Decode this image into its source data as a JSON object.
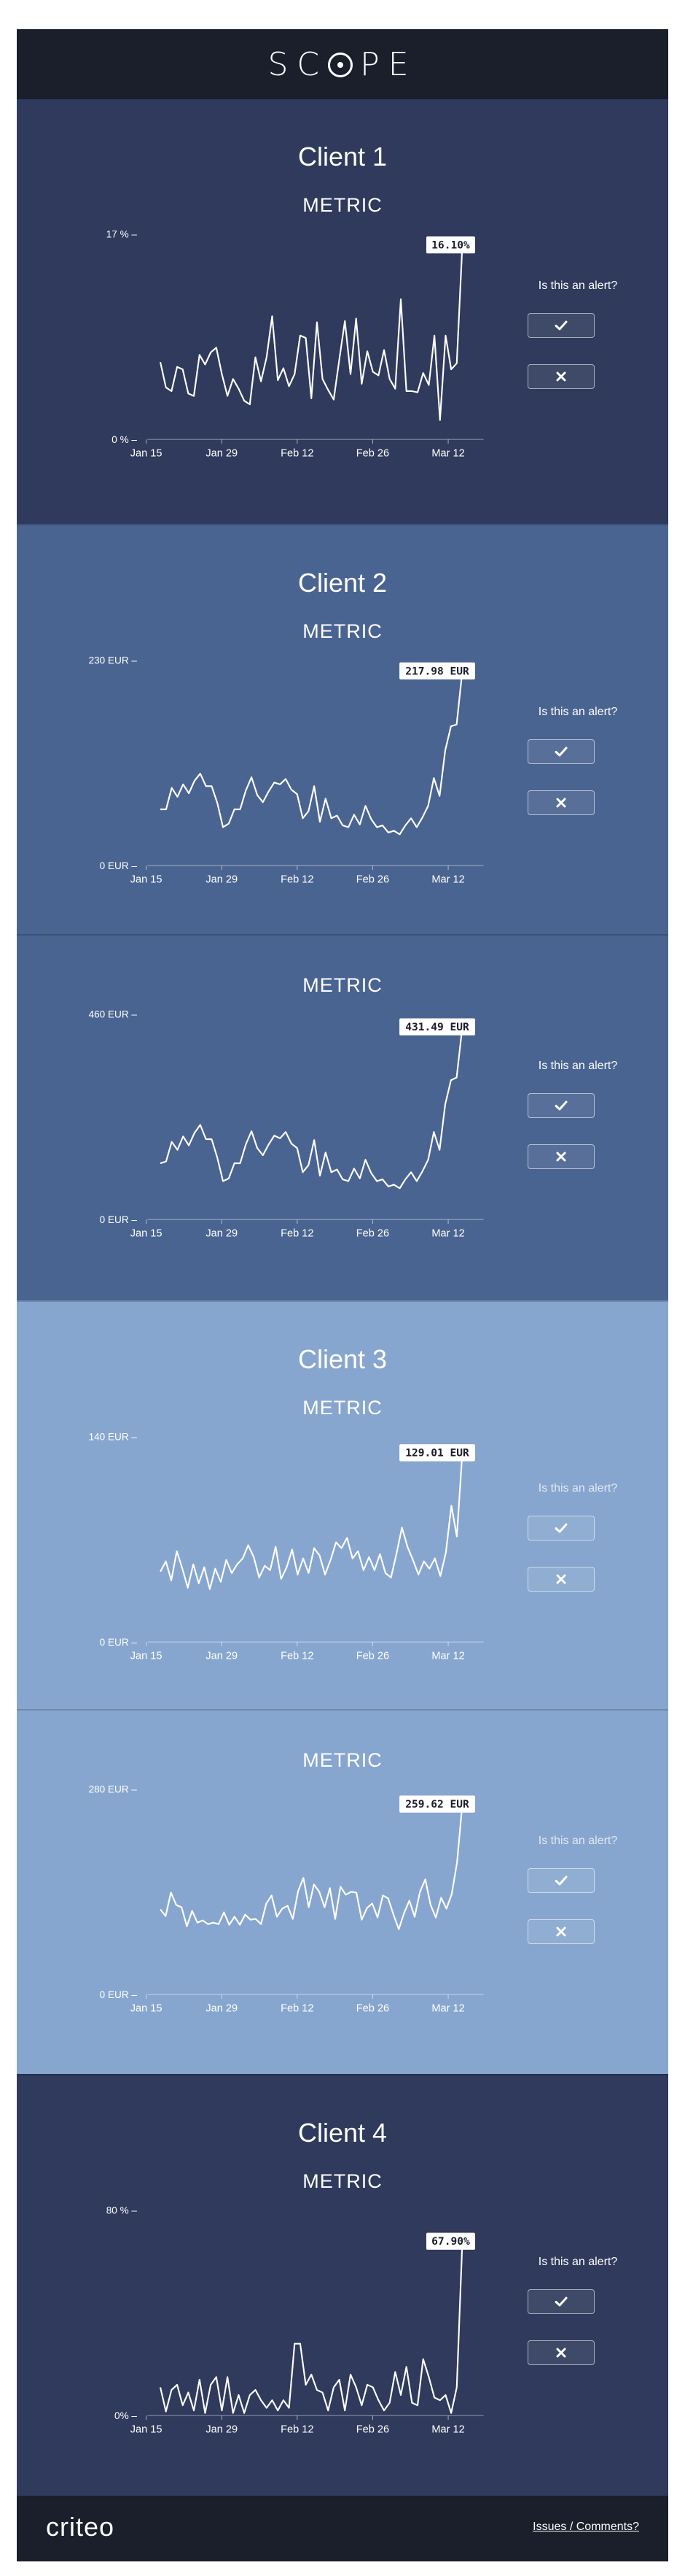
{
  "header": {
    "logo_text": "SC",
    "logo_text_end": "PE"
  },
  "alert": {
    "question": "Is this an alert?",
    "confirm_icon": "check-icon",
    "reject_icon": "cross-icon"
  },
  "colors": {
    "header_bg": "#1b1e2b",
    "client_dark": "#2f3a5c",
    "client_mid": "#4a6491",
    "client_light": "#87a6cf",
    "line": "#ffffff"
  },
  "sections": [
    {
      "client": "Client 1",
      "charts": [
        {
          "metric": "METRIC",
          "ymax_label": "17 % –",
          "ymin_label": "0 % –",
          "badge": "16.10%",
          "xticks": [
            "Jan 15",
            "Jan 29",
            "Feb 12",
            "Feb 26",
            "Mar 12"
          ],
          "chart_data": {
            "type": "line",
            "ylim": [
              0,
              17
            ],
            "values": [
              6.4,
              4.3,
              4,
              6,
              5.8,
              3.8,
              3.6,
              7,
              6.2,
              7.2,
              7.6,
              5.4,
              3.6,
              5,
              4.2,
              3.2,
              2.9,
              6.8,
              4.8,
              6.8,
              10.2,
              4.9,
              5.9,
              4.4,
              5.4,
              8.6,
              8.4,
              3.4,
              9.7,
              5,
              4.1,
              3.3,
              6.6,
              9.8,
              5.4,
              10,
              4.6,
              7.3,
              5.6,
              5.3,
              7.4,
              5,
              4.2,
              11.6,
              4,
              4,
              3.9,
              5.5,
              4.5,
              8.6,
              1.6,
              8.6,
              5.8,
              6.3,
              16.1
            ]
          }
        }
      ]
    },
    {
      "client": "Client 2",
      "charts": [
        {
          "metric": "METRIC",
          "ymax_label": "230 EUR –",
          "ymin_label": "0 EUR –",
          "badge": "217.98 EUR",
          "xticks": [
            "Jan 15",
            "Jan 29",
            "Feb 12",
            "Feb 26",
            "Mar 12"
          ],
          "chart_data": {
            "type": "line",
            "ylim": [
              0,
              230
            ],
            "values": [
              63,
              63,
              87,
              77,
              91,
              81,
              95,
              103,
              89,
              89,
              70,
              43,
              47,
              63,
              63,
              84,
              99,
              79,
              71,
              83,
              93,
              91,
              97,
              85,
              80,
              53,
              61,
              89,
              49,
              75,
              53,
              56,
              45,
              43,
              57,
              46,
              67,
              52,
              43,
              45,
              37,
              39,
              35,
              45,
              53,
              43,
              54,
              67,
              98,
              78,
              129,
              156,
              158,
              217.98
            ]
          }
        },
        {
          "metric": "METRIC",
          "ymax_label": "460 EUR –",
          "ymin_label": "0 EUR –",
          "badge": "431.49 EUR",
          "xticks": [
            "Jan 15",
            "Jan 29",
            "Feb 12",
            "Feb 26",
            "Mar 12"
          ],
          "chart_data": {
            "type": "line",
            "ylim": [
              0,
              460
            ],
            "values": [
              126,
              130,
              174,
              156,
              186,
              166,
              194,
              212,
              180,
              180,
              138,
              86,
              92,
              126,
              126,
              168,
              198,
              160,
              144,
              168,
              188,
              182,
              196,
              170,
              160,
              106,
              122,
              178,
              98,
              150,
              106,
              112,
              90,
              86,
              114,
              92,
              134,
              104,
              86,
              90,
              74,
              78,
              70,
              90,
              106,
              86,
              108,
              134,
              196,
              156,
              258,
              312,
              318,
              431.49
            ]
          }
        }
      ]
    },
    {
      "client": "Client 3",
      "charts": [
        {
          "metric": "METRIC",
          "ymax_label": "140 EUR –",
          "ymin_label": "0 EUR –",
          "badge": "129.01 EUR",
          "xticks": [
            "Jan 15",
            "Jan 29",
            "Feb 12",
            "Feb 26",
            "Mar 12"
          ],
          "chart_data": {
            "type": "line",
            "ylim": [
              0,
              140
            ],
            "values": [
              48,
              55,
              42,
              62,
              50,
              37,
              53,
              40,
              51,
              36,
              50,
              41,
              56,
              47,
              53,
              57,
              66,
              58,
              44,
              52,
              49,
              65,
              43,
              51,
              63,
              46,
              57,
              47,
              64,
              59,
              46,
              56,
              68,
              64,
              71,
              57,
              62,
              49,
              58,
              49,
              60,
              47,
              44,
              60,
              78,
              65,
              56,
              46,
              55,
              50,
              57,
              45,
              61,
              93,
              72,
              129.01
            ]
          }
        },
        {
          "metric": "METRIC",
          "ymax_label": "280 EUR –",
          "ymin_label": "0 EUR –",
          "badge": "259.62 EUR",
          "xticks": [
            "Jan 15",
            "Jan 29",
            "Feb 12",
            "Feb 26",
            "Mar 12"
          ],
          "chart_data": {
            "type": "line",
            "ylim": [
              0,
              280
            ],
            "values": [
              116,
              107,
              139,
              122,
              119,
              93,
              114,
              98,
              101,
              96,
              98,
              96,
              112,
              95,
              106,
              95,
              109,
              102,
              103,
              96,
              124,
              135,
              106,
              117,
              121,
              103,
              141,
              159,
              119,
              150,
              140,
              119,
              145,
              103,
              147,
              136,
              140,
              139,
              102,
              118,
              124,
              105,
              135,
              131,
              109,
              89,
              111,
              128,
              106,
              140,
              157,
              122,
              105,
              132,
              117,
              137,
              180,
              259.62
            ]
          }
        }
      ]
    },
    {
      "client": "Client 4",
      "charts": [
        {
          "metric": "METRIC",
          "ymax_label": "80 % –",
          "ymin_label": "0% –",
          "badge": "67.90%",
          "xticks": [
            "Jan 15",
            "Jan 29",
            "Feb 12",
            "Feb 26",
            "Mar 12"
          ],
          "chart_data": {
            "type": "line",
            "ylim": [
              0,
              80
            ],
            "values": [
              11,
              1.6,
              10,
              12,
              4,
              9,
              2,
              14,
              1,
              12,
              15,
              2,
              15,
              1,
              8,
              1,
              8,
              10,
              6,
              3,
              6,
              2,
              6,
              3,
              28,
              28,
              12,
              16,
              10,
              9,
              2,
              11,
              14,
              2,
              16,
              11,
              4,
              12,
              11,
              6,
              2,
              5,
              17,
              8,
              19,
              5,
              4,
              22,
              15,
              7,
              6,
              8,
              1,
              11,
              67.9
            ]
          }
        }
      ]
    }
  ],
  "footer": {
    "brand": "criteo",
    "issues_link": "Issues / Comments?"
  }
}
